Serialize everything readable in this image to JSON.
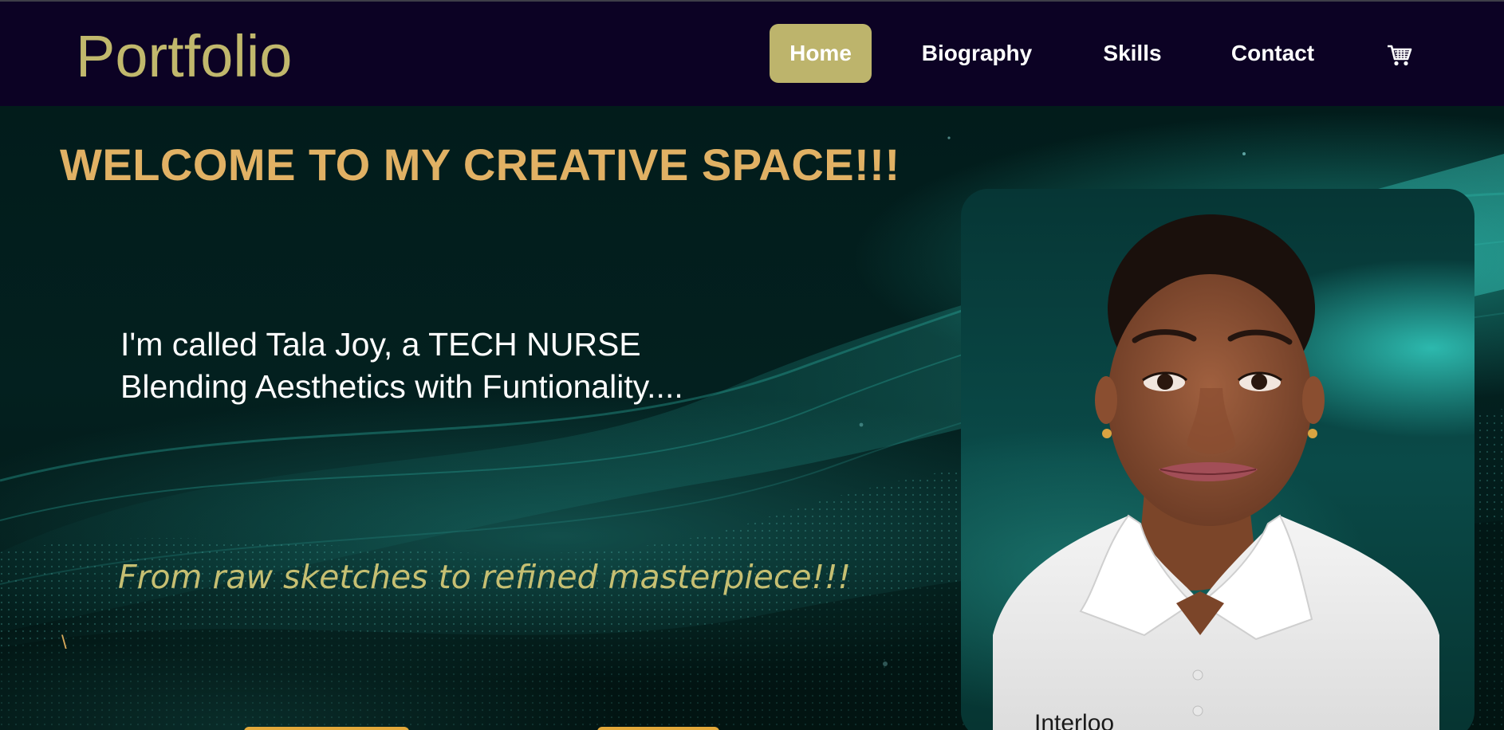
{
  "nav": {
    "brand": "Portfolio",
    "links": [
      {
        "label": "Home",
        "active": true
      },
      {
        "label": "Biography",
        "active": false
      },
      {
        "label": "Skills",
        "active": false
      },
      {
        "label": "Contact",
        "active": false
      }
    ],
    "cart_icon": "shopping-cart-icon"
  },
  "hero": {
    "welcome": "WELCOME TO MY CREATIVE SPACE!!!",
    "intro": "I'm called Tala Joy, a TECH NURSE Blending Aesthetics with Funtionality....",
    "tagline": "From raw sketches to refined masterpiece!!!",
    "stray_mark": "\\",
    "shirt_logo": "Interloo"
  },
  "colors": {
    "nav_background": "#0c0224",
    "brand": "#c1b86c",
    "active_tab": "#bdb46c",
    "welcome": "#e1b164",
    "tagline": "#c6bf72",
    "cta": "#e4a93a"
  }
}
